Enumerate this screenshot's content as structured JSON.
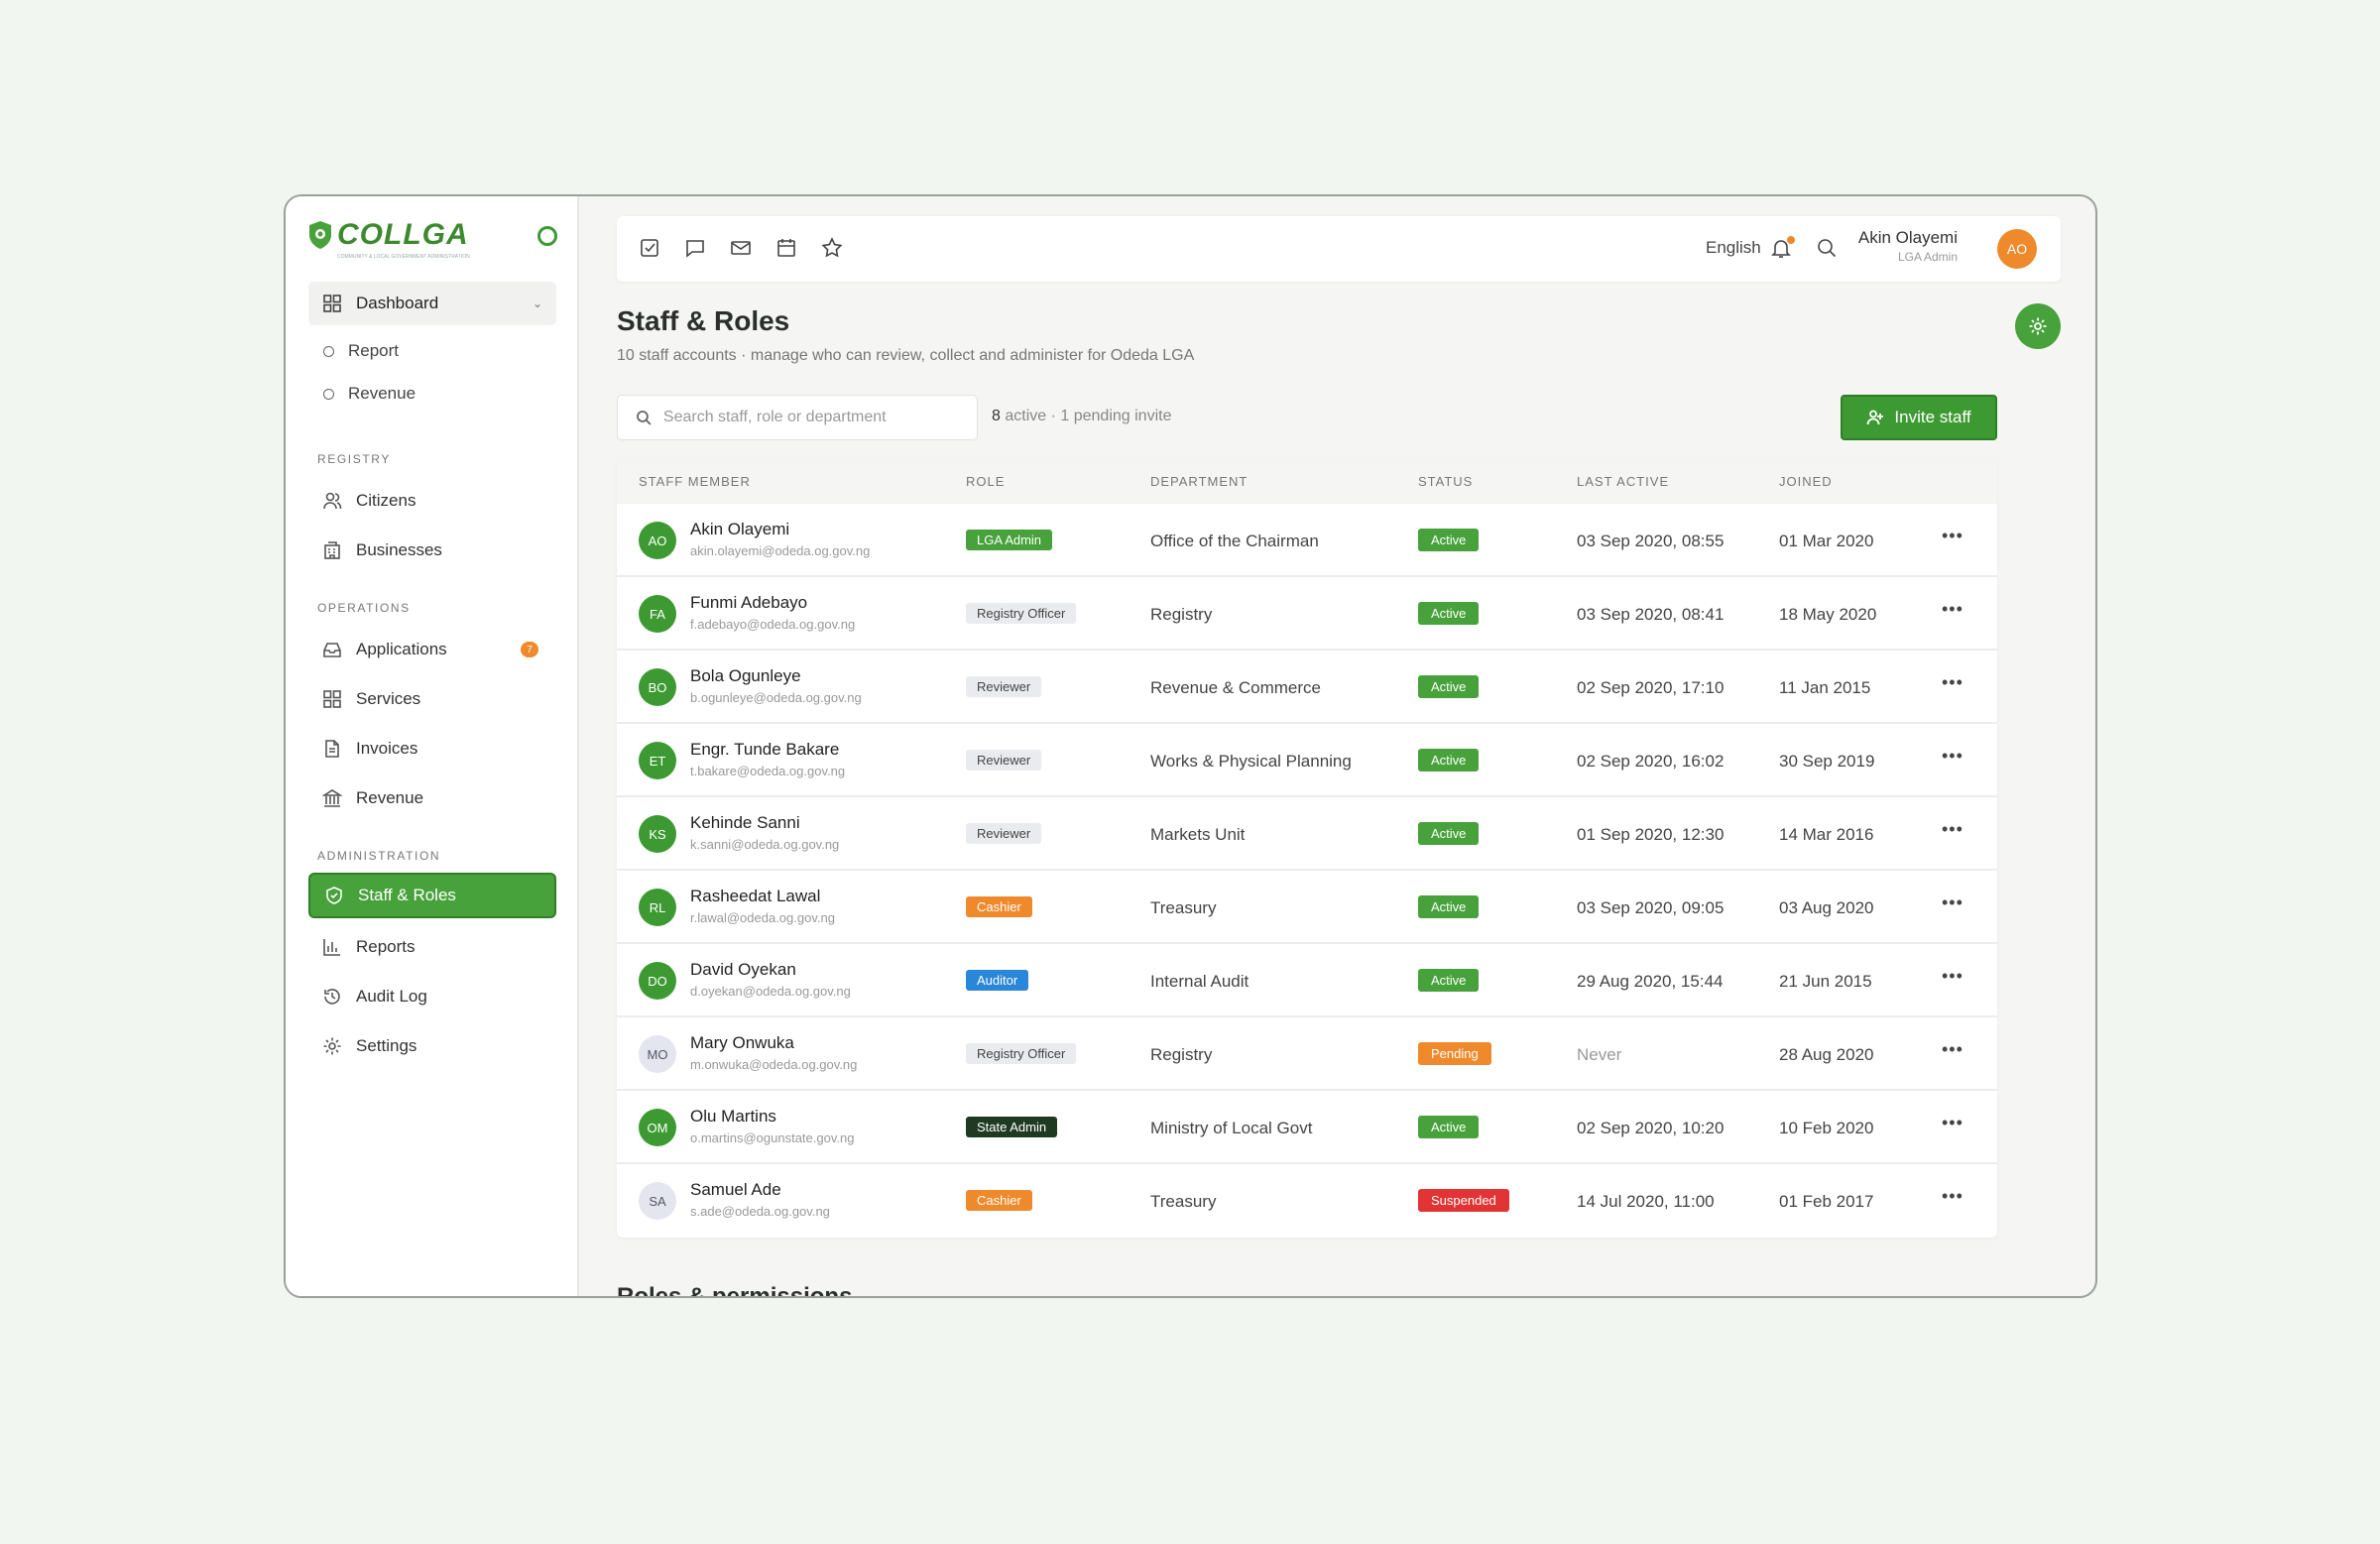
{
  "brand": {
    "name": "COLLGA",
    "tagline": "COMMUNITY & LOCAL GOVERNMENT ADMINISTRATION"
  },
  "sidebar": {
    "dashboard": "Dashboard",
    "sub_items": [
      "Report",
      "Revenue"
    ],
    "sections": [
      {
        "title": "REGISTRY",
        "items": [
          {
            "label": "Citizens",
            "icon": "users-icon"
          },
          {
            "label": "Businesses",
            "icon": "building-icon"
          }
        ]
      },
      {
        "title": "OPERATIONS",
        "items": [
          {
            "label": "Applications",
            "icon": "inbox-icon",
            "badge": "7"
          },
          {
            "label": "Services",
            "icon": "grid-icon"
          },
          {
            "label": "Invoices",
            "icon": "document-icon"
          },
          {
            "label": "Revenue",
            "icon": "bank-icon"
          }
        ]
      },
      {
        "title": "ADMINISTRATION",
        "items": [
          {
            "label": "Staff & Roles",
            "icon": "shield-icon",
            "active": true
          },
          {
            "label": "Reports",
            "icon": "bar-chart-icon"
          },
          {
            "label": "Audit Log",
            "icon": "history-icon"
          },
          {
            "label": "Settings",
            "icon": "gear-icon"
          }
        ]
      }
    ]
  },
  "topbar": {
    "icons": [
      "checkbox-icon",
      "chat-icon",
      "mail-icon",
      "calendar-icon",
      "star-icon"
    ],
    "language": "English",
    "user_name": "Akin Olayemi",
    "user_role": "LGA Admin",
    "user_initials": "AO"
  },
  "page": {
    "title": "Staff & Roles",
    "subtitle": "10 staff accounts · manage who can review, collect and administer for Odeda LGA",
    "search_placeholder": "Search staff, role or department",
    "active_count": "8",
    "counts_rest": "active · 1 pending invite",
    "invite_label": "Invite staff",
    "next_section": "Roles & permissions"
  },
  "table": {
    "headers": [
      "STAFF MEMBER",
      "ROLE",
      "DEPARTMENT",
      "STATUS",
      "LAST ACTIVE",
      "JOINED"
    ],
    "rows": [
      {
        "initials": "AO",
        "name": "Akin Olayemi",
        "email": "akin.olayemi@odeda.og.gov.ng",
        "role": "LGA Admin",
        "dept": "Office of the Chairman",
        "status": "Active",
        "last": "03 Sep 2020, 08:55",
        "joined": "01 Mar 2020"
      },
      {
        "initials": "FA",
        "name": "Funmi Adebayo",
        "email": "f.adebayo@odeda.og.gov.ng",
        "role": "Registry Officer",
        "dept": "Registry",
        "status": "Active",
        "last": "03 Sep 2020, 08:41",
        "joined": "18 May 2020"
      },
      {
        "initials": "BO",
        "name": "Bola Ogunleye",
        "email": "b.ogunleye@odeda.og.gov.ng",
        "role": "Reviewer",
        "dept": "Revenue & Commerce",
        "status": "Active",
        "last": "02 Sep 2020, 17:10",
        "joined": "11 Jan 2015"
      },
      {
        "initials": "ET",
        "name": "Engr. Tunde Bakare",
        "email": "t.bakare@odeda.og.gov.ng",
        "role": "Reviewer",
        "dept": "Works & Physical Planning",
        "status": "Active",
        "last": "02 Sep 2020, 16:02",
        "joined": "30 Sep 2019"
      },
      {
        "initials": "KS",
        "name": "Kehinde Sanni",
        "email": "k.sanni@odeda.og.gov.ng",
        "role": "Reviewer",
        "dept": "Markets Unit",
        "status": "Active",
        "last": "01 Sep 2020, 12:30",
        "joined": "14 Mar 2016"
      },
      {
        "initials": "RL",
        "name": "Rasheedat Lawal",
        "email": "r.lawal@odeda.og.gov.ng",
        "role": "Cashier",
        "dept": "Treasury",
        "status": "Active",
        "last": "03 Sep 2020, 09:05",
        "joined": "03 Aug 2020"
      },
      {
        "initials": "DO",
        "name": "David Oyekan",
        "email": "d.oyekan@odeda.og.gov.ng",
        "role": "Auditor",
        "dept": "Internal Audit",
        "status": "Active",
        "last": "29 Aug 2020, 15:44",
        "joined": "21 Jun 2015"
      },
      {
        "initials": "MO",
        "name": "Mary Onwuka",
        "email": "m.onwuka@odeda.og.gov.ng",
        "role": "Registry Officer",
        "dept": "Registry",
        "status": "Pending",
        "last": "Never",
        "joined": "28 Aug 2020"
      },
      {
        "initials": "OM",
        "name": "Olu Martins",
        "email": "o.martins@ogunstate.gov.ng",
        "role": "State Admin",
        "dept": "Ministry of Local Govt",
        "status": "Active",
        "last": "02 Sep 2020, 10:20",
        "joined": "10 Feb 2020"
      },
      {
        "initials": "SA",
        "name": "Samuel Ade",
        "email": "s.ade@odeda.og.gov.ng",
        "role": "Cashier",
        "dept": "Treasury",
        "status": "Suspended",
        "last": "14 Jul 2020, 11:00",
        "joined": "01 Feb 2017"
      }
    ]
  },
  "colors": {
    "accent": "#47a23b",
    "orange": "#ef8a2c",
    "blue": "#2a86d8",
    "red": "#e23434",
    "dark": "#1f3a22"
  }
}
